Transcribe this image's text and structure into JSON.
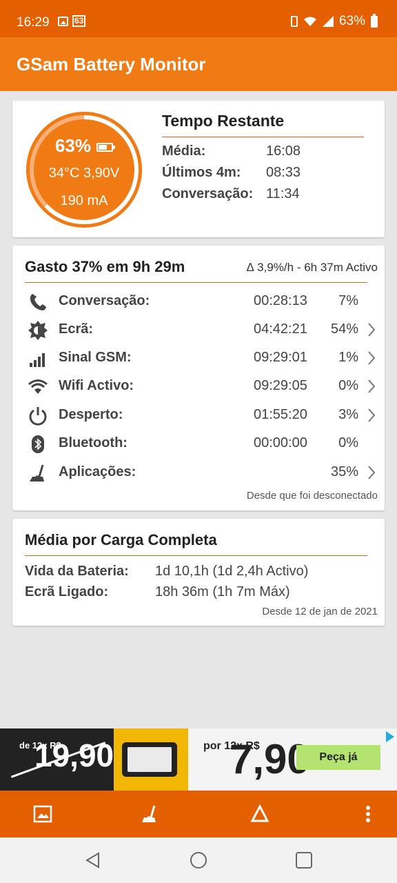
{
  "status_bar": {
    "time": "16:29",
    "badge": "63",
    "battery_pct": "63%"
  },
  "app_bar": {
    "title": "GSam Battery Monitor"
  },
  "battery_card": {
    "gauge": {
      "percent": "63%",
      "temp_voltage": "34°C  3,90V",
      "current": "190 mA",
      "level": 0.63,
      "color": "#f07a14"
    },
    "title": "Tempo Restante",
    "rows": [
      {
        "label": "Média:",
        "value": "16:08"
      },
      {
        "label": "Últimos 4m:",
        "value": "08:33"
      },
      {
        "label": "Conversação:",
        "value": "11:34"
      }
    ]
  },
  "usage_card": {
    "title": "Gasto 37% em 9h 29m",
    "subtitle": "∆ 3,9%/h - 6h 37m Activo",
    "rows": [
      {
        "icon": "phone-icon",
        "label": "Conversação:",
        "duration": "00:28:13",
        "percent": "7%",
        "chevron": false
      },
      {
        "icon": "brightness-icon",
        "label": "Ecrã:",
        "duration": "04:42:21",
        "percent": "54%",
        "chevron": true
      },
      {
        "icon": "signal-icon",
        "label": "Sinal GSM:",
        "duration": "09:29:01",
        "percent": "1%",
        "chevron": true
      },
      {
        "icon": "wifi-icon",
        "label": "Wifi Activo:",
        "duration": "09:29:05",
        "percent": "0%",
        "chevron": true
      },
      {
        "icon": "power-icon",
        "label": "Desperto:",
        "duration": "01:55:20",
        "percent": "3%",
        "chevron": true
      },
      {
        "icon": "bluetooth-icon",
        "label": "Bluetooth:",
        "duration": "00:00:00",
        "percent": "0%",
        "chevron": false
      },
      {
        "icon": "apps-icon",
        "label": "Aplicações:",
        "duration": "",
        "percent": "35%",
        "chevron": true
      }
    ],
    "footer": "Desde que foi desconectado"
  },
  "average_card": {
    "title": "Média por Carga Completa",
    "rows": [
      {
        "label": "Vida da Bateria:",
        "value": "1d 10,1h (1d 2,4h Activo)"
      },
      {
        "label": "Ecrã Ligado:",
        "value": "18h 36m (1h 7m Máx)"
      }
    ],
    "footer": "Desde 12 de jan de 2021"
  },
  "ad": {
    "old_label": "de 12x R$",
    "old_price": "19,90",
    "new_label": "por 12x R$",
    "new_price": "7,90",
    "cta": "Peça já"
  },
  "bottom_bar": {
    "icons": [
      "image-icon",
      "apps-icon",
      "delta-icon",
      "more-icon"
    ]
  },
  "nav_bar": {
    "icons": [
      "back-icon",
      "home-icon",
      "recents-icon"
    ]
  },
  "colors": {
    "accent": "#f07a14",
    "status": "#e45f00",
    "rule": "#d2691e"
  }
}
